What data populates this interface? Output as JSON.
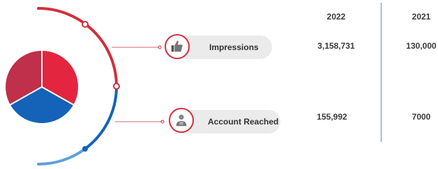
{
  "colors": {
    "red": "#d32f3c",
    "dark_red": "#c0304a",
    "blue": "#1463b8",
    "light_blue": "#5fa0d8",
    "pill": "#ebebeb"
  },
  "columns": [
    "2022",
    "2021"
  ],
  "metrics": [
    {
      "label": "Impressions",
      "icon": "thumbs-up-icon",
      "values": [
        "3,158,731",
        "130,000"
      ]
    },
    {
      "label": "Account Reached",
      "icon": "user-group-icon",
      "values": [
        "155,992",
        "7000"
      ]
    }
  ]
}
